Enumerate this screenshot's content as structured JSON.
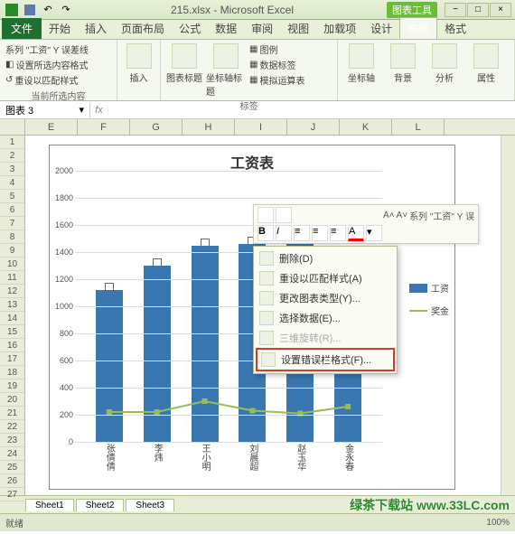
{
  "titlebar": {
    "filename": "215.xlsx - Microsoft Excel",
    "contextual_label": "图表工具"
  },
  "window_buttons": {
    "min": "−",
    "max": "□",
    "close": "×"
  },
  "ribbon_tabs": {
    "file": "文件",
    "tabs": [
      "开始",
      "插入",
      "页面布局",
      "公式",
      "数据",
      "审阅",
      "视图",
      "加载项"
    ],
    "contextual": [
      "设计",
      "布局",
      "格式"
    ],
    "active": "布局"
  },
  "ribbon": {
    "group1": {
      "label": "当前所选内容",
      "items": [
        "系列 \"工资\" Y 误差线",
        "设置所选内容格式",
        "重设以匹配样式"
      ]
    },
    "group2": {
      "label": "",
      "insert": "插入"
    },
    "group3": {
      "label": "标签",
      "items": [
        "图表标题",
        "坐标轴标题",
        "图例",
        "数据标签",
        "模拟运算表"
      ]
    },
    "group4": {
      "label": "",
      "items": [
        "坐标轴",
        "背景",
        "分析",
        "属性"
      ]
    }
  },
  "namebox": {
    "value": "图表 3",
    "fx": "fx"
  },
  "columns": [
    "E",
    "F",
    "G",
    "H",
    "I",
    "J",
    "K",
    "L"
  ],
  "rows_start": 1,
  "rows_end": 27,
  "chart_data": {
    "type": "combo",
    "title": "工资表",
    "categories": [
      "张倩倩",
      "李炜",
      "王小明",
      "刘晨超",
      "赵玉华",
      "金永春"
    ],
    "ylim": [
      0,
      2000
    ],
    "yticks": [
      0,
      200,
      400,
      600,
      800,
      1000,
      1200,
      1400,
      1600,
      1800,
      2000
    ],
    "series": [
      {
        "name": "工资",
        "type": "bar",
        "color": "#3a76b0",
        "values": [
          1120,
          1300,
          1450,
          1460,
          1700,
          1340
        ]
      },
      {
        "name": "奖金",
        "type": "line",
        "color": "#9bbb59",
        "values": [
          220,
          220,
          300,
          230,
          210,
          260
        ]
      }
    ],
    "legend": [
      "工资",
      "奖金"
    ]
  },
  "mini_toolbar": {
    "series_label": "系列 \"工资\" Y 误"
  },
  "context_menu": {
    "items": [
      {
        "label": "删除(D)",
        "enabled": true
      },
      {
        "label": "重设以匹配样式(A)",
        "enabled": true
      },
      {
        "label": "更改图表类型(Y)...",
        "enabled": true
      },
      {
        "label": "选择数据(E)...",
        "enabled": true
      },
      {
        "label": "三维旋转(R)...",
        "enabled": false
      },
      {
        "label": "设置错误栏格式(F)...",
        "enabled": true,
        "highlight": true
      }
    ]
  },
  "sheet_tabs": [
    "Sheet1",
    "Sheet2",
    "Sheet3"
  ],
  "statusbar": {
    "mode": "就绪",
    "zoom": "100%"
  },
  "watermark": "绿茶下载站 www.33LC.com"
}
